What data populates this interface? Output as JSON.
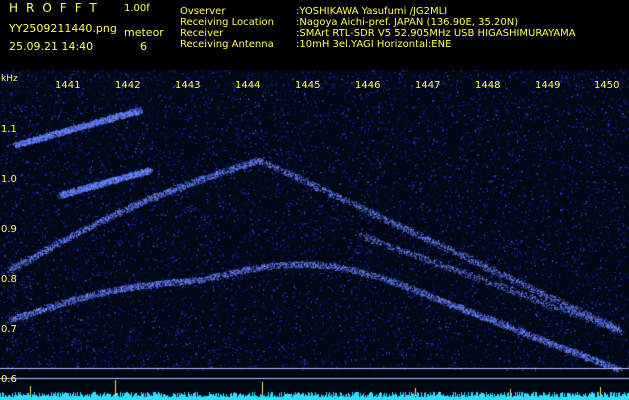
{
  "header": {
    "brand": "HROFFT",
    "version": "1.00f",
    "filename": "YY2509211440.png",
    "count_label": "meteor",
    "datetime": "25.09.21 14:40",
    "count_value": "6",
    "info": [
      {
        "key": "Ovserver",
        "value": ":YOSHIKAWA Yasufumi /JG2MLI"
      },
      {
        "key": "Receiving Location",
        "value": ":Nagoya Aichi-pref. JAPAN (136.90E, 35.20N)"
      },
      {
        "key": "Receiver",
        "value": ":SMArt RTL-SDR V5 52.905MHz USB HIGASHIMURAYAMA"
      },
      {
        "key": "Receiving Antenna",
        "value": ":10mH 3el.YAGI Horizontal:ENE"
      }
    ]
  },
  "plot": {
    "unit": "kHz",
    "xticks": [
      "1441",
      "1442",
      "1443",
      "1444",
      "1445",
      "1446",
      "1447",
      "1448",
      "1449",
      "1450"
    ],
    "yticks": [
      "1.1",
      "1.0",
      "0.9",
      "0.8",
      "0.7",
      "0.6"
    ],
    "colors": {
      "noise": "#1c2cb8",
      "signal": "#7f9bff",
      "baseline": "#33ddff",
      "ticks": "#ffff55"
    }
  }
}
